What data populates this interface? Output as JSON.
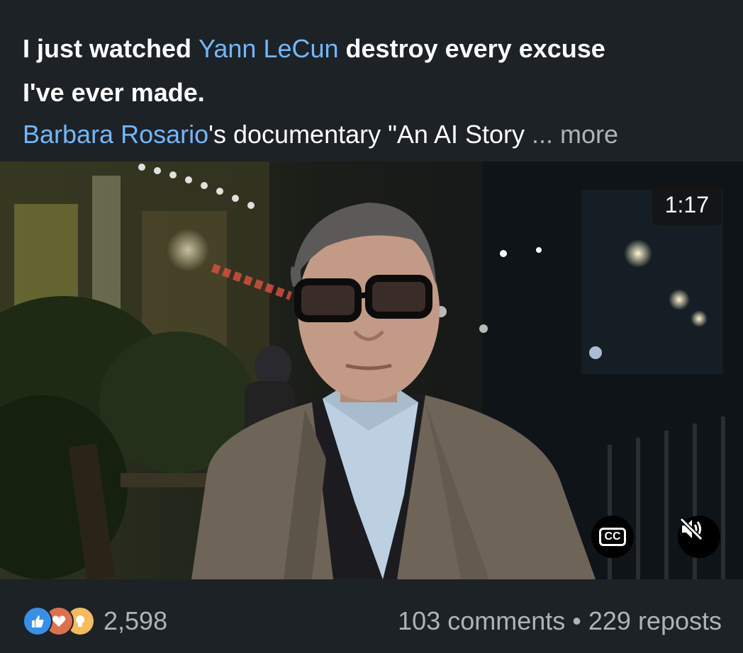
{
  "post": {
    "headline_part1": "I just watched ",
    "headline_mention": "Yann LeCun",
    "headline_part2": " destroy every excuse",
    "headline_line2": "I've ever made.",
    "line3_mention": "Barbara Rosario",
    "line3_rest": "'s documentary \"An AI Story ",
    "more_label": "... more"
  },
  "video": {
    "duration": "1:17",
    "cc_label": "CC",
    "mute_icon": "speaker-muted-icon"
  },
  "footer": {
    "reaction_icons": [
      "like-icon",
      "love-icon",
      "insightful-icon"
    ],
    "reaction_count": "2,598",
    "comments": "103 comments",
    "separator": " • ",
    "reposts": "229 reposts"
  },
  "colors": {
    "background": "#1d2226",
    "mention": "#71b7fb",
    "muted_text": "#b0b3b6",
    "like": "#378fe9",
    "love": "#df704d",
    "insightful": "#f5bb5c"
  }
}
